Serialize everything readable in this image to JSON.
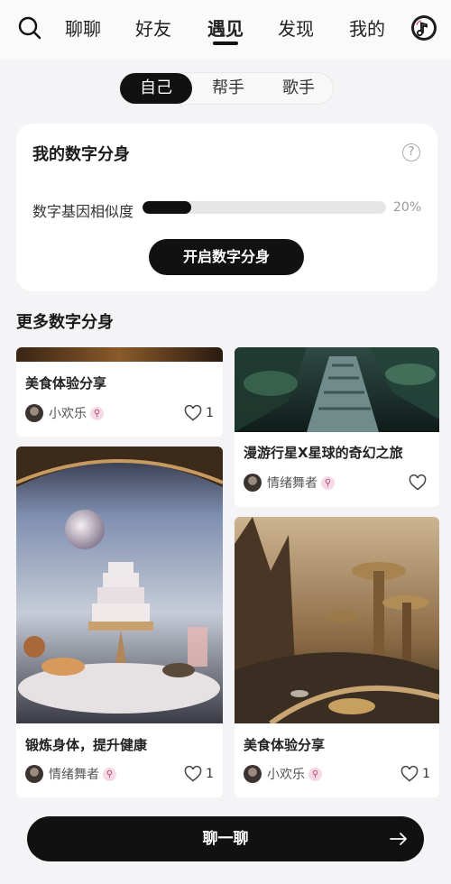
{
  "nav": {
    "tabs": [
      "聊聊",
      "好友",
      "遇见",
      "发现",
      "我的"
    ],
    "active_tab": "遇见"
  },
  "segments": {
    "items": [
      "自己",
      "帮手",
      "歌手"
    ],
    "active": "自己"
  },
  "digital_twin": {
    "title": "我的数字分身",
    "help_symbol": "?",
    "similarity_label": "数字基因相似度",
    "similarity_value": "20%",
    "similarity_fraction": 0.2,
    "open_button": "开启数字分身"
  },
  "more_section": {
    "title": "更多数字分身"
  },
  "cards": [
    {
      "title": "美食体验分享",
      "author": "小欢乐",
      "likes": "1"
    },
    {
      "title": "漫游行星X星球的奇幻之旅",
      "author": "情绪舞者",
      "likes": ""
    },
    {
      "title": "锻炼身体，提升健康",
      "author": "情绪舞者",
      "likes": "1"
    },
    {
      "title": "美食体验分享",
      "author": "小欢乐",
      "likes": "1"
    }
  ],
  "icons": {
    "search": "search-icon",
    "music": "music-note-icon",
    "help": "question-circle-icon",
    "heart": "heart-icon",
    "badge": "magnifier-badge-icon",
    "arrow": "arrow-right-icon"
  },
  "chat_button": {
    "label": "聊一聊"
  },
  "colors": {
    "primary": "#111111",
    "background": "#f4f4f6",
    "badge": "#f6d9e4"
  }
}
